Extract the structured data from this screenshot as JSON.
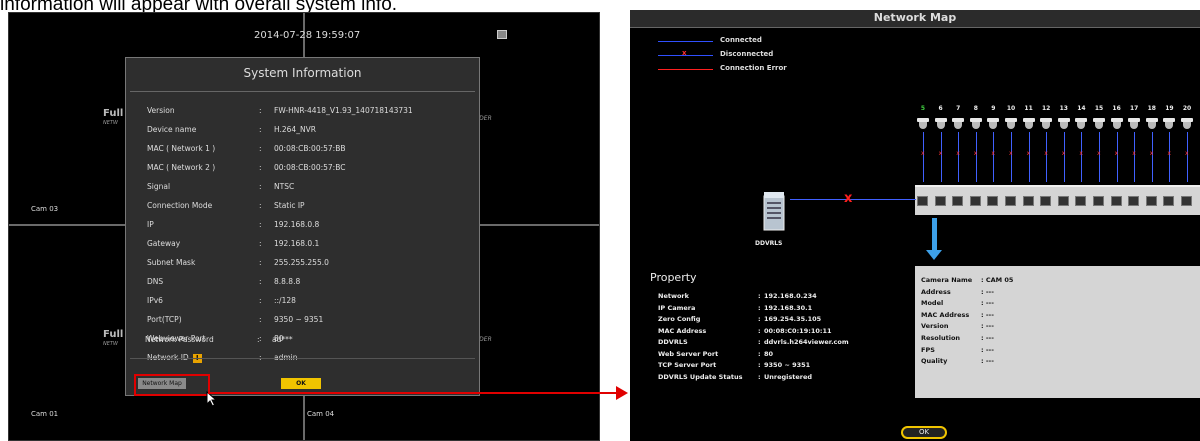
{
  "caption": "information will appear with overall system info.",
  "left": {
    "datetime": "2014-07-28 19:59:07",
    "cams": [
      "Cam 03",
      "Cam 01",
      "Cam 04"
    ],
    "brand_top": "Full",
    "brand_bottom": "Full",
    "brand_sub": "NETW",
    "brand_right": "RDER",
    "dialog": {
      "title": "System Information",
      "rows": [
        {
          "key": "Version",
          "value": "FW-HNR-4418_V1.93_140718143731"
        },
        {
          "key": "Device name",
          "value": "H.264_NVR"
        },
        {
          "key": "MAC ( Network 1 )",
          "value": "00:08:CB:00:57:BB"
        },
        {
          "key": "MAC ( Network 2 )",
          "value": "00:08:CB:00:57:BC"
        },
        {
          "key": "Signal",
          "value": "NTSC"
        },
        {
          "key": "Connection Mode",
          "value": "Static IP"
        },
        {
          "key": "IP",
          "value": "192.168.0.8"
        },
        {
          "key": "Gateway",
          "value": "192.168.0.1"
        },
        {
          "key": "Subnet Mask",
          "value": "255.255.255.0"
        },
        {
          "key": "DNS",
          "value": "8.8.8.8"
        },
        {
          "key": "IPv6",
          "value": "::/128"
        },
        {
          "key": "Port(TCP)",
          "value": "9350 ~ 9351"
        },
        {
          "key": "Webviewer Port",
          "value": "80"
        },
        {
          "key": "Network ID",
          "value": "admin"
        },
        {
          "key": "Network Password",
          "value": "ad***"
        }
      ],
      "colon": ":",
      "warn_glyph": "!",
      "network_map_label": "Network Map",
      "ok_label": "OK"
    }
  },
  "right": {
    "title": "Network Map",
    "legend": [
      {
        "label": "Connected",
        "color": "#3050ff"
      },
      {
        "label": "Disconnected",
        "color": "#3050ff"
      },
      {
        "label": "Connection Error",
        "color": "#ff2020"
      }
    ],
    "ports": [
      "5",
      "6",
      "7",
      "8",
      "9",
      "10",
      "11",
      "12",
      "13",
      "14",
      "15",
      "16",
      "17",
      "18",
      "19",
      "20"
    ],
    "x_mark": "x",
    "server_label": "DDVRLS",
    "property": {
      "title": "Property",
      "rows": [
        {
          "key": "Network",
          "value": "192.168.0.234"
        },
        {
          "key": "IP Camera",
          "value": "192.168.30.1"
        },
        {
          "key": "Zero Config",
          "value": "169.254.35.105"
        },
        {
          "key": "MAC Address",
          "value": "00:08:C0:19:10:11"
        },
        {
          "key": "DDVRLS",
          "value": "ddvrls.h264viewer.com"
        },
        {
          "key": "Web Server Port",
          "value": "80"
        },
        {
          "key": "TCP Server Port",
          "value": "9350 ~ 9351"
        },
        {
          "key": "DDVRLS Update Status",
          "value": "Unregistered"
        }
      ]
    },
    "camera": {
      "rows": [
        {
          "key": "Camera Name",
          "value": ":  CAM 05"
        },
        {
          "key": "Address",
          "value": ":  ---"
        },
        {
          "key": "Model",
          "value": ":  ---"
        },
        {
          "key": "MAC Address",
          "value": ":  ---"
        },
        {
          "key": "Version",
          "value": ":  ---"
        },
        {
          "key": "Resolution",
          "value": ":  ---"
        },
        {
          "key": "FPS",
          "value": ":  ---"
        },
        {
          "key": "Quality",
          "value": ":  ---"
        }
      ]
    },
    "ok_label": "OK",
    "colors": {
      "first_port": "#40d040",
      "switch": "#d5d5d5",
      "arrow": "#3da0e8",
      "accent": "#e00000"
    }
  }
}
